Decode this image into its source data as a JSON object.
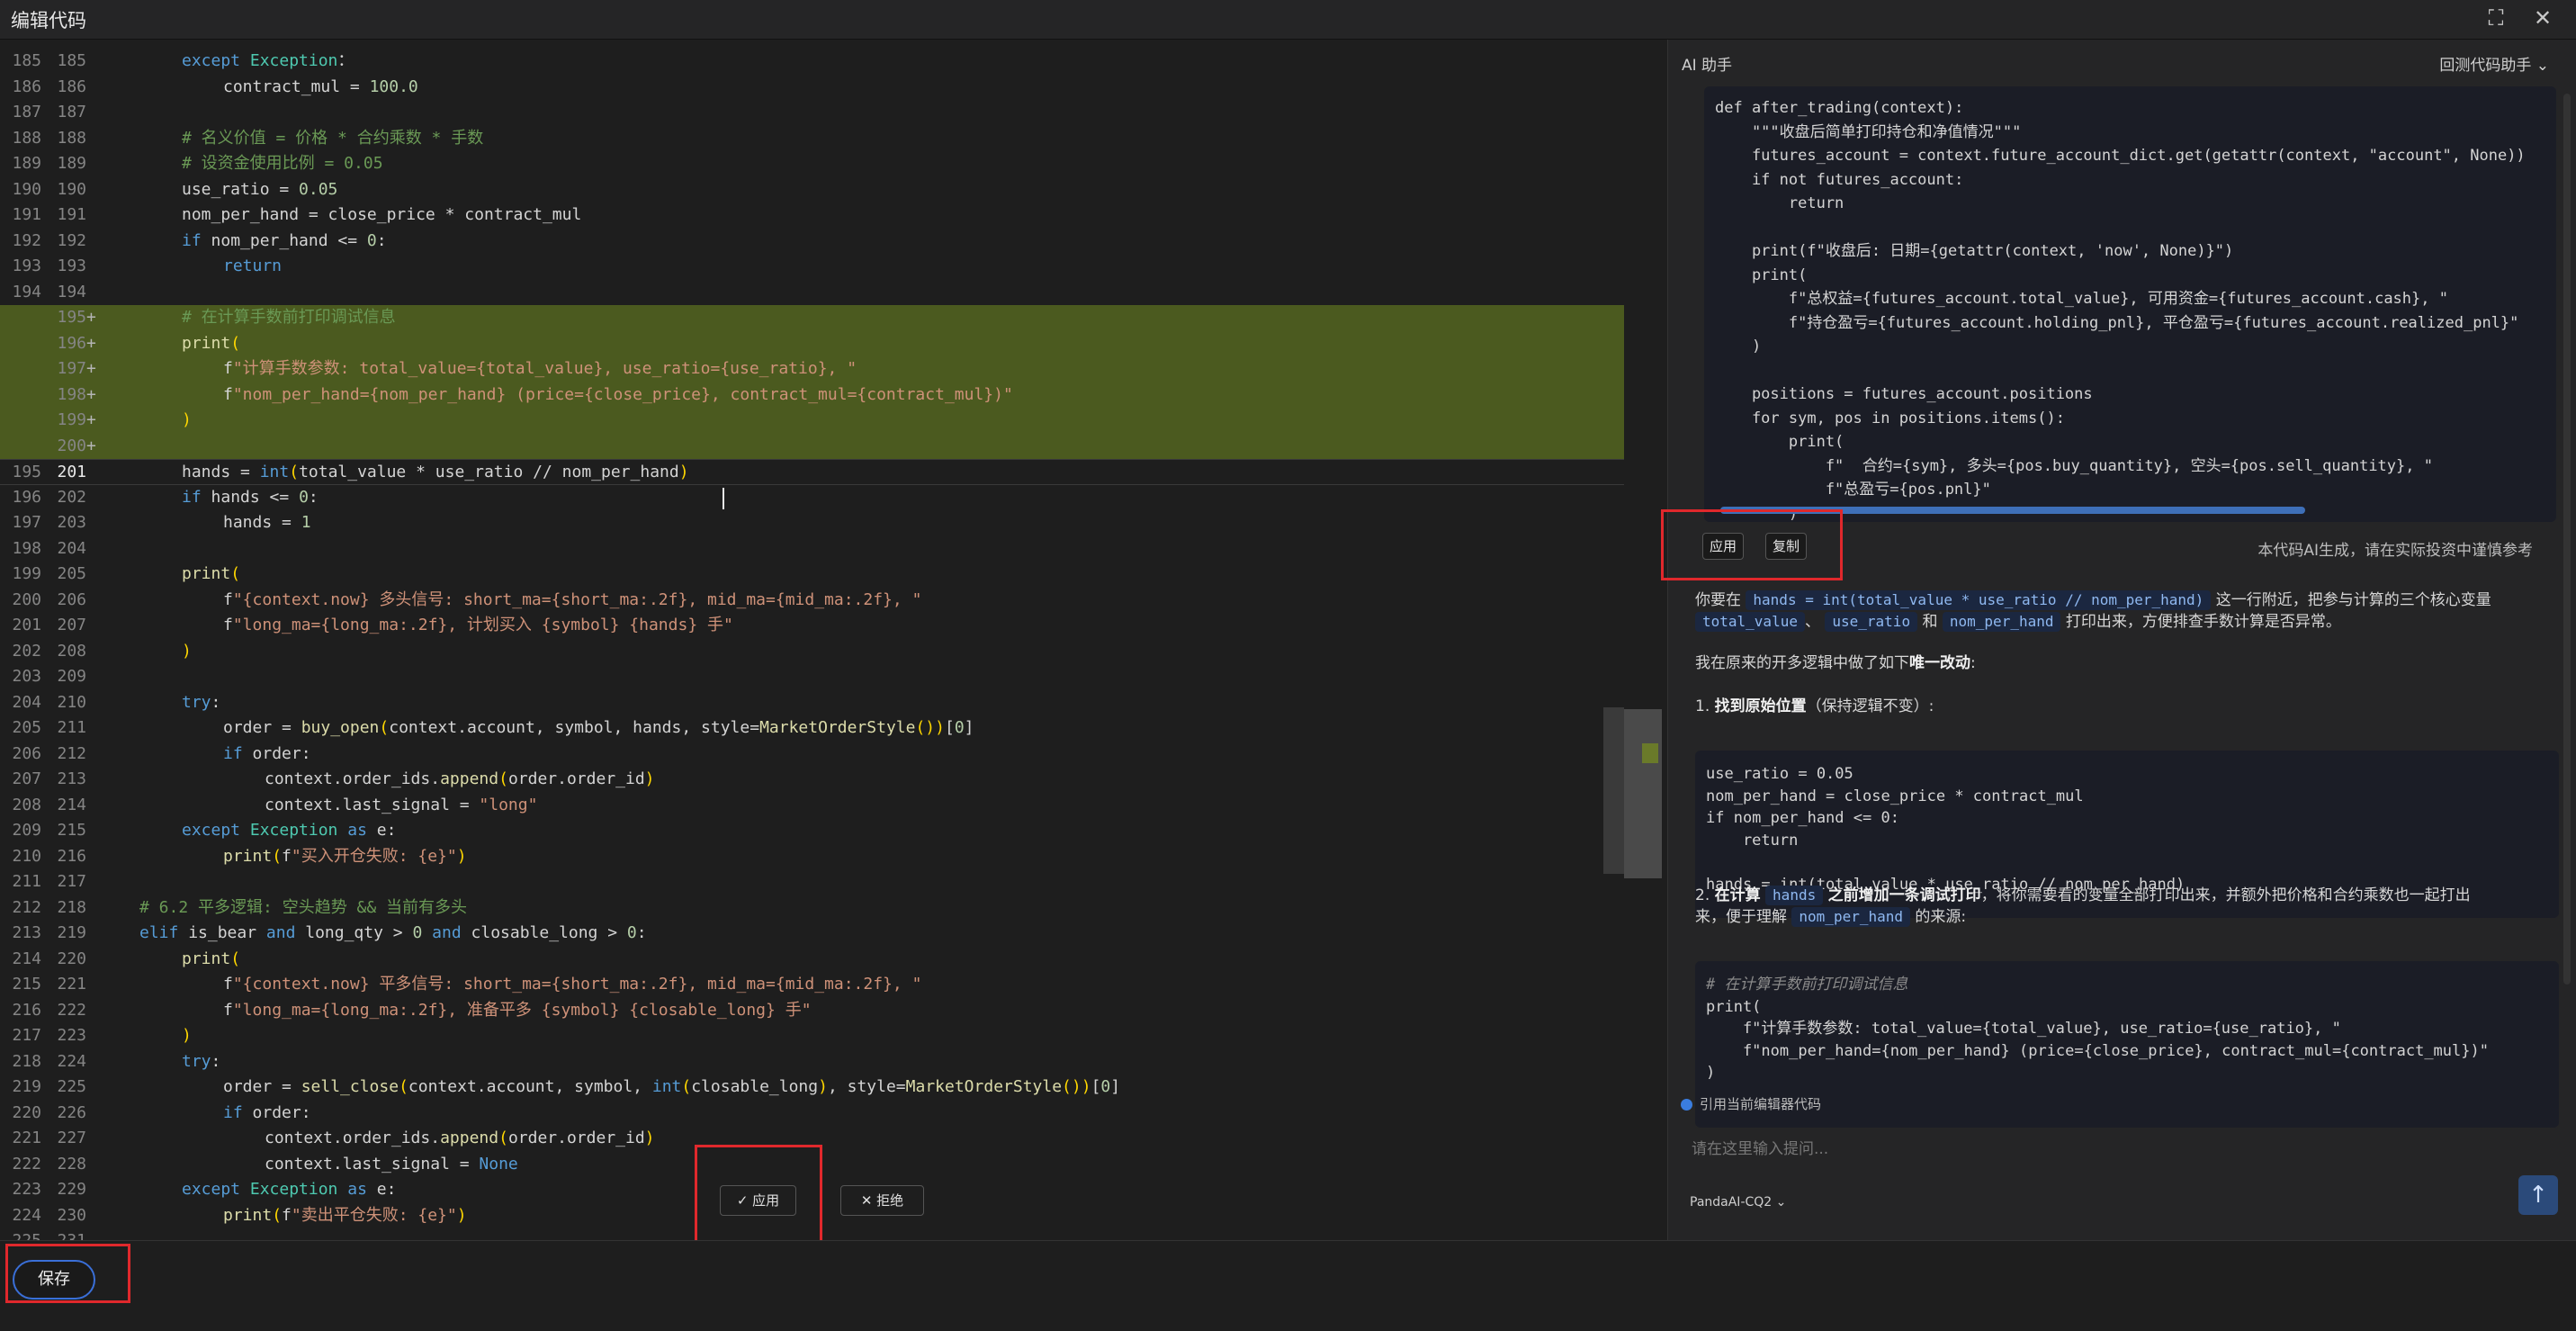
{
  "window": {
    "title": "编辑代码"
  },
  "editor": {
    "lines": [
      {
        "ln1": "185",
        "ln2": "185",
        "added": false,
        "indent": 2,
        "segs": [
          [
            "kw",
            "except "
          ],
          [
            "bi",
            "Exception"
          ],
          [
            "",
            "："
          ]
        ]
      },
      {
        "ln1": "186",
        "ln2": "186",
        "added": false,
        "indent": 3,
        "segs": [
          [
            "",
            "contract_mul = "
          ],
          [
            "nu",
            "100.0"
          ]
        ]
      },
      {
        "ln1": "187",
        "ln2": "187",
        "added": false,
        "indent": 0,
        "segs": []
      },
      {
        "ln1": "188",
        "ln2": "188",
        "added": false,
        "indent": 2,
        "segs": [
          [
            "cm",
            "# 名义价值 = 价格 * 合约乘数 * 手数"
          ]
        ]
      },
      {
        "ln1": "189",
        "ln2": "189",
        "added": false,
        "indent": 2,
        "segs": [
          [
            "cm",
            "# 设资金使用比例 = 0.05"
          ]
        ]
      },
      {
        "ln1": "190",
        "ln2": "190",
        "added": false,
        "indent": 2,
        "segs": [
          [
            "",
            "use_ratio = "
          ],
          [
            "nu",
            "0.05"
          ]
        ]
      },
      {
        "ln1": "191",
        "ln2": "191",
        "added": false,
        "indent": 2,
        "segs": [
          [
            "",
            "nom_per_hand = close_price * contract_mul"
          ]
        ]
      },
      {
        "ln1": "192",
        "ln2": "192",
        "added": false,
        "indent": 2,
        "segs": [
          [
            "kw",
            "if "
          ],
          [
            "",
            "nom_per_hand <= "
          ],
          [
            "nu",
            "0"
          ],
          [
            "",
            ":"
          ]
        ]
      },
      {
        "ln1": "193",
        "ln2": "193",
        "added": false,
        "indent": 3,
        "segs": [
          [
            "kw",
            "return"
          ]
        ]
      },
      {
        "ln1": "194",
        "ln2": "194",
        "added": false,
        "indent": 0,
        "segs": []
      },
      {
        "ln1": "",
        "ln2": "195",
        "added": true,
        "indent": 2,
        "segs": [
          [
            "cm",
            "# 在计算手数前打印调试信息"
          ]
        ]
      },
      {
        "ln1": "",
        "ln2": "196",
        "added": true,
        "indent": 2,
        "segs": [
          [
            "fn",
            "print"
          ],
          [
            "bk",
            "("
          ]
        ]
      },
      {
        "ln1": "",
        "ln2": "197",
        "added": true,
        "indent": 3,
        "segs": [
          [
            "",
            "f"
          ],
          [
            "st",
            "\"计算手数参数: total_value={total_value}, use_ratio={use_ratio}, \""
          ]
        ]
      },
      {
        "ln1": "",
        "ln2": "198",
        "added": true,
        "indent": 3,
        "segs": [
          [
            "",
            "f"
          ],
          [
            "st",
            "\"nom_per_hand={nom_per_hand} (price={close_price}, contract_mul={contract_mul})\""
          ]
        ]
      },
      {
        "ln1": "",
        "ln2": "199",
        "added": true,
        "indent": 2,
        "segs": [
          [
            "bk",
            ")"
          ]
        ]
      },
      {
        "ln1": "",
        "ln2": "200",
        "added": true,
        "indent": 0,
        "segs": []
      },
      {
        "ln1": "195",
        "ln2": "201",
        "added": false,
        "current": true,
        "indent": 2,
        "segs": [
          [
            "",
            "hands = "
          ],
          [
            "kw",
            "int"
          ],
          [
            "bk",
            "("
          ],
          [
            "",
            "total_value * use_ratio // nom_per_hand"
          ],
          [
            "bk",
            ")"
          ]
        ]
      },
      {
        "ln1": "196",
        "ln2": "202",
        "added": false,
        "indent": 2,
        "segs": [
          [
            "kw",
            "if "
          ],
          [
            "",
            "hands <= "
          ],
          [
            "nu",
            "0"
          ],
          [
            "",
            ":"
          ]
        ]
      },
      {
        "ln1": "197",
        "ln2": "203",
        "added": false,
        "indent": 3,
        "segs": [
          [
            "",
            "hands = "
          ],
          [
            "nu",
            "1"
          ]
        ]
      },
      {
        "ln1": "198",
        "ln2": "204",
        "added": false,
        "indent": 0,
        "segs": []
      },
      {
        "ln1": "199",
        "ln2": "205",
        "added": false,
        "indent": 2,
        "segs": [
          [
            "fn",
            "print"
          ],
          [
            "bk",
            "("
          ]
        ]
      },
      {
        "ln1": "200",
        "ln2": "206",
        "added": false,
        "indent": 3,
        "segs": [
          [
            "",
            "f"
          ],
          [
            "st",
            "\"{context.now} 多头信号: short_ma={short_ma:.2f}, mid_ma={mid_ma:.2f}, \""
          ]
        ]
      },
      {
        "ln1": "201",
        "ln2": "207",
        "added": false,
        "indent": 3,
        "segs": [
          [
            "",
            "f"
          ],
          [
            "st",
            "\"long_ma={long_ma:.2f}, 计划买入 {symbol} {hands} 手\""
          ]
        ]
      },
      {
        "ln1": "202",
        "ln2": "208",
        "added": false,
        "indent": 2,
        "segs": [
          [
            "bk",
            ")"
          ]
        ]
      },
      {
        "ln1": "203",
        "ln2": "209",
        "added": false,
        "indent": 0,
        "segs": []
      },
      {
        "ln1": "204",
        "ln2": "210",
        "added": false,
        "indent": 2,
        "segs": [
          [
            "kw",
            "try"
          ],
          [
            "",
            ":"
          ]
        ]
      },
      {
        "ln1": "205",
        "ln2": "211",
        "added": false,
        "indent": 3,
        "segs": [
          [
            "",
            "order = "
          ],
          [
            "fn",
            "buy_open"
          ],
          [
            "bk",
            "("
          ],
          [
            "",
            "context.account, symbol, hands, style="
          ],
          [
            "fn",
            "MarketOrderStyle"
          ],
          [
            "bk",
            "("
          ],
          [
            "bk",
            ")"
          ],
          [
            "bk",
            ")"
          ],
          [
            "",
            "["
          ],
          [
            "nu",
            "0"
          ],
          [
            "",
            "]"
          ]
        ]
      },
      {
        "ln1": "206",
        "ln2": "212",
        "added": false,
        "indent": 3,
        "segs": [
          [
            "kw",
            "if "
          ],
          [
            "",
            "order:"
          ]
        ]
      },
      {
        "ln1": "207",
        "ln2": "213",
        "added": false,
        "indent": 4,
        "segs": [
          [
            "",
            "context.order_ids."
          ],
          [
            "fn",
            "append"
          ],
          [
            "bk",
            "("
          ],
          [
            "",
            "order.order_id"
          ],
          [
            "bk",
            ")"
          ]
        ]
      },
      {
        "ln1": "208",
        "ln2": "214",
        "added": false,
        "indent": 4,
        "segs": [
          [
            "",
            "context.last_signal = "
          ],
          [
            "st",
            "\"long\""
          ]
        ]
      },
      {
        "ln1": "209",
        "ln2": "215",
        "added": false,
        "indent": 2,
        "segs": [
          [
            "kw",
            "except "
          ],
          [
            "bi",
            "Exception "
          ],
          [
            "kw",
            "as "
          ],
          [
            "",
            "e:"
          ]
        ]
      },
      {
        "ln1": "210",
        "ln2": "216",
        "added": false,
        "indent": 3,
        "segs": [
          [
            "fn",
            "print"
          ],
          [
            "bk",
            "("
          ],
          [
            "",
            "f"
          ],
          [
            "st",
            "\"买入开仓失败: {e}\""
          ],
          [
            "bk",
            ")"
          ]
        ]
      },
      {
        "ln1": "211",
        "ln2": "217",
        "added": false,
        "indent": 0,
        "segs": []
      },
      {
        "ln1": "212",
        "ln2": "218",
        "added": false,
        "indent": 1,
        "segs": [
          [
            "cm",
            "# 6.2 平多逻辑: 空头趋势 && 当前有多头"
          ]
        ]
      },
      {
        "ln1": "213",
        "ln2": "219",
        "added": false,
        "indent": 1,
        "segs": [
          [
            "kw",
            "elif "
          ],
          [
            "",
            "is_bear "
          ],
          [
            "kw",
            "and "
          ],
          [
            "",
            "long_qty > "
          ],
          [
            "nu",
            "0 "
          ],
          [
            "kw",
            "and "
          ],
          [
            "",
            "closable_long > "
          ],
          [
            "nu",
            "0"
          ],
          [
            "",
            ":"
          ]
        ]
      },
      {
        "ln1": "214",
        "ln2": "220",
        "added": false,
        "indent": 2,
        "segs": [
          [
            "fn",
            "print"
          ],
          [
            "bk",
            "("
          ]
        ]
      },
      {
        "ln1": "215",
        "ln2": "221",
        "added": false,
        "indent": 3,
        "segs": [
          [
            "",
            "f"
          ],
          [
            "st",
            "\"{context.now} 平多信号: short_ma={short_ma:.2f}, mid_ma={mid_ma:.2f}, \""
          ]
        ]
      },
      {
        "ln1": "216",
        "ln2": "222",
        "added": false,
        "indent": 3,
        "segs": [
          [
            "",
            "f"
          ],
          [
            "st",
            "\"long_ma={long_ma:.2f}, 准备平多 {symbol} {closable_long} 手\""
          ]
        ]
      },
      {
        "ln1": "217",
        "ln2": "223",
        "added": false,
        "indent": 2,
        "segs": [
          [
            "bk",
            ")"
          ]
        ]
      },
      {
        "ln1": "218",
        "ln2": "224",
        "added": false,
        "indent": 2,
        "segs": [
          [
            "kw",
            "try"
          ],
          [
            "",
            ":"
          ]
        ]
      },
      {
        "ln1": "219",
        "ln2": "225",
        "added": false,
        "indent": 3,
        "segs": [
          [
            "",
            "order = "
          ],
          [
            "fn",
            "sell_close"
          ],
          [
            "bk",
            "("
          ],
          [
            "",
            "context.account, symbol, "
          ],
          [
            "kw",
            "int"
          ],
          [
            "bk",
            "("
          ],
          [
            "",
            "closable_long"
          ],
          [
            "bk",
            ")"
          ],
          [
            "",
            ", style="
          ],
          [
            "fn",
            "MarketOrderStyle"
          ],
          [
            "bk",
            "("
          ],
          [
            "bk",
            ")"
          ],
          [
            "bk",
            ")"
          ],
          [
            "",
            "["
          ],
          [
            "nu",
            "0"
          ],
          [
            "",
            "]"
          ]
        ]
      },
      {
        "ln1": "220",
        "ln2": "226",
        "added": false,
        "indent": 3,
        "segs": [
          [
            "kw",
            "if "
          ],
          [
            "",
            "order:"
          ]
        ]
      },
      {
        "ln1": "221",
        "ln2": "227",
        "added": false,
        "indent": 4,
        "segs": [
          [
            "",
            "context.order_ids."
          ],
          [
            "fn",
            "append"
          ],
          [
            "bk",
            "("
          ],
          [
            "",
            "order.order_id"
          ],
          [
            "bk",
            ")"
          ]
        ]
      },
      {
        "ln1": "222",
        "ln2": "228",
        "added": false,
        "indent": 4,
        "segs": [
          [
            "",
            "context.last_signal = "
          ],
          [
            "nn",
            "None"
          ]
        ]
      },
      {
        "ln1": "223",
        "ln2": "229",
        "added": false,
        "indent": 2,
        "segs": [
          [
            "kw",
            "except "
          ],
          [
            "bi",
            "Exception "
          ],
          [
            "kw",
            "as "
          ],
          [
            "",
            "e:"
          ]
        ]
      },
      {
        "ln1": "224",
        "ln2": "230",
        "added": false,
        "indent": 3,
        "segs": [
          [
            "fn",
            "print"
          ],
          [
            "bk",
            "("
          ],
          [
            "",
            "f"
          ],
          [
            "st",
            "\"卖出平仓失败: {e}\""
          ],
          [
            "bk",
            ")"
          ]
        ]
      },
      {
        "ln1": "225",
        "ln2": "231",
        "added": false,
        "indent": 0,
        "segs": []
      }
    ],
    "apply_label": "✓ 应用",
    "reject_label": "✕ 拒绝"
  },
  "footer": {
    "save_label": "保存"
  },
  "assistant": {
    "title": "AI 助手",
    "mode_dropdown": "回测代码助手 ⌄",
    "code_block_1": [
      "def after_trading(context):",
      "    \"\"\"收盘后简单打印持仓和净值情况\"\"\"",
      "    futures_account = context.future_account_dict.get(getattr(context, \"account\", None))",
      "    if not futures_account:",
      "        return",
      "",
      "    print(f\"收盘后: 日期={getattr(context, 'now', None)}\")",
      "    print(",
      "        f\"总权益={futures_account.total_value}, 可用资金={futures_account.cash}, \"",
      "        f\"持仓盈亏={futures_account.holding_pnl}, 平仓盈亏={futures_account.realized_pnl}\"",
      "    )",
      "",
      "    positions = futures_account.positions",
      "    for sym, pos in positions.items():",
      "        print(",
      "            f\"  合约={sym}, 多头={pos.buy_quantity}, 空头={pos.sell_quantity}, \"",
      "            f\"总盈亏={pos.pnl}\"",
      "        )"
    ],
    "apply_label": "应用",
    "copy_label": "复制",
    "disclaimer": "本代码AI生成，请在实际投资中谨慎参考",
    "p1_a": "你要在",
    "p1_chip1": "hands = int(total_value * use_ratio // nom_per_hand)",
    "p1_b": "这一行附近，把参与计算的三个核心变量",
    "p1_chip2": "total_value",
    "p1_sep": "、",
    "p1_chip3": "use_ratio",
    "p1_and": "和",
    "p1_chip4": "nom_per_hand",
    "p1_c": "打印出来，方便排查手数计算是否异常。",
    "p2_a": "我在原来的开多逻辑中做了如下",
    "p2_bold": "唯一改动",
    "p2_b": ":",
    "step1_num": "1.",
    "step1_bold": "找到原始位置",
    "step1_rest": "（保持逻辑不变）:",
    "code_block_2": [
      "use_ratio = 0.05",
      "nom_per_hand = close_price * contract_mul",
      "if nom_per_hand <= 0:",
      "    return",
      "",
      "hands = int(total_value * use_ratio // nom_per_hand)"
    ],
    "step2_num": "2.",
    "step2_bold_a": "在计算",
    "step2_chip": "hands",
    "step2_bold_b": "之前增加一条调试打印",
    "step2_rest": "，将你需要看的变量全部打印出来，并额外把价格和合约乘数也一起打出",
    "step2_line2_a": "来，便于理解",
    "step2_chip2": "nom_per_hand",
    "step2_line2_b": "的来源:",
    "code_block_3": [
      "# 在计算手数前打印调试信息",
      "print(",
      "    f\"计算手数参数: total_value={total_value}, use_ratio={use_ratio}, \"",
      "    f\"nom_per_hand={nom_per_hand} (price={close_price}, contract_mul={contract_mul})\"",
      ")"
    ],
    "cite_label": "引用当前编辑器代码",
    "input_placeholder": "请在这里输入提问...",
    "model_label": "PandaAI-CQ2 ⌄"
  },
  "colors": {
    "accent": "#3a6fd8",
    "annotation_red": "#e0282c",
    "added_line_bg": "#4b5a1f"
  }
}
